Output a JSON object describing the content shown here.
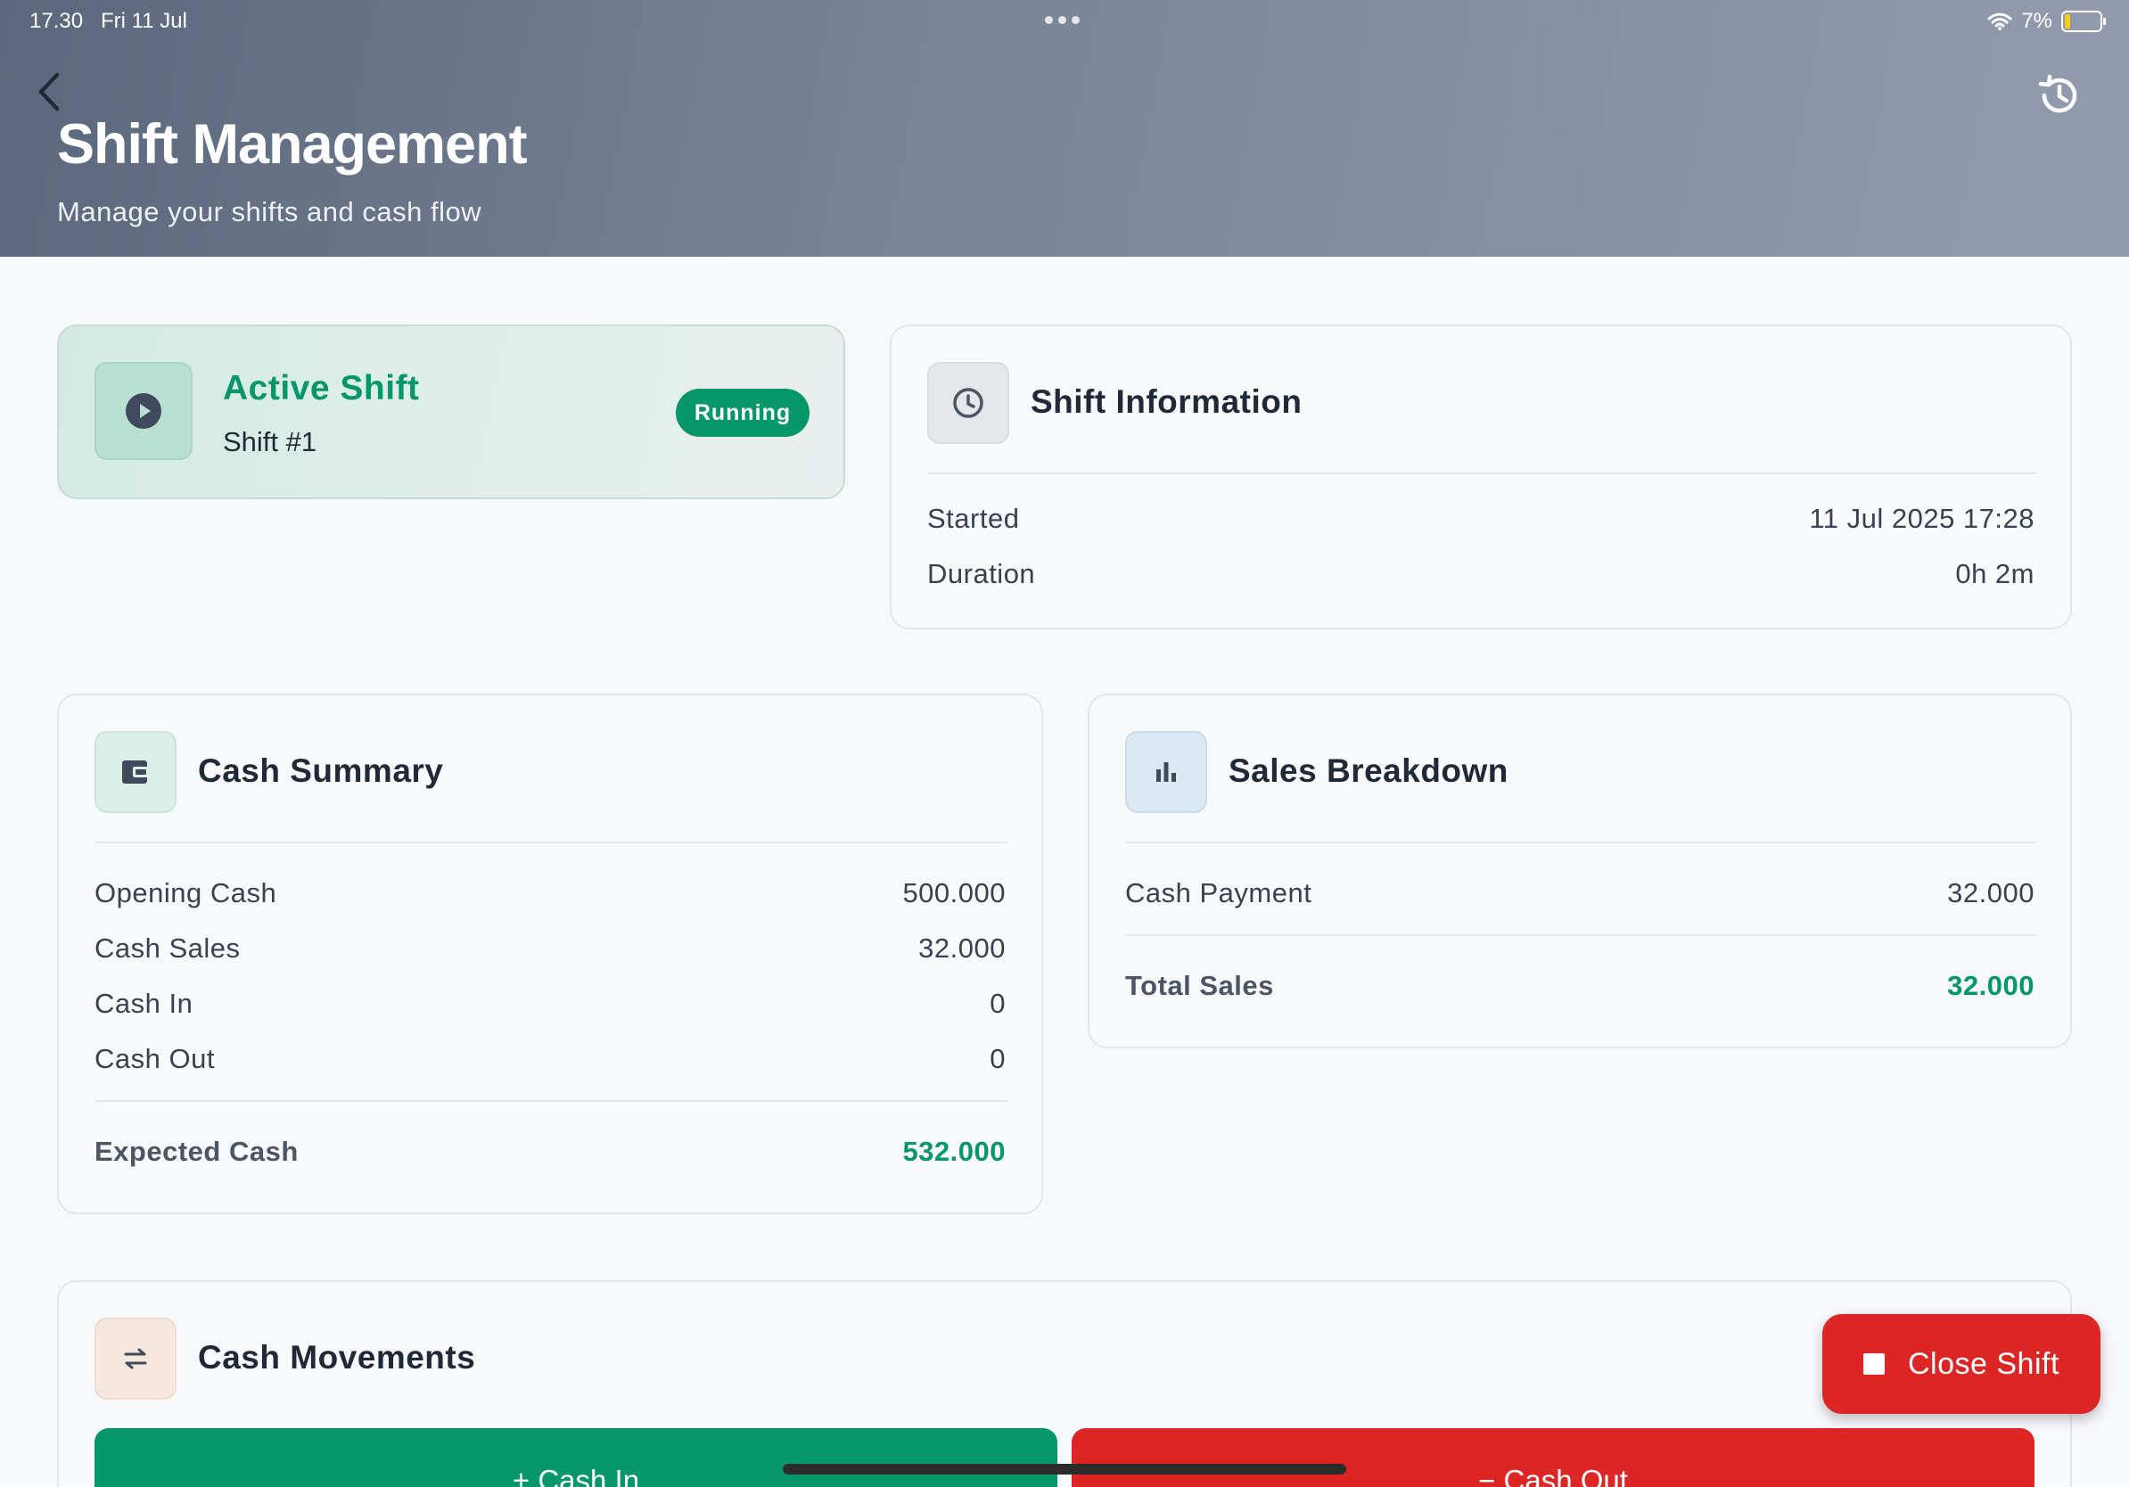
{
  "status_bar": {
    "time": "17.30",
    "date": "Fri 11 Jul",
    "battery": "7%"
  },
  "header": {
    "title": "Shift Management",
    "subtitle": "Manage your shifts and cash flow",
    "back_icon": "chevron-left-icon",
    "history_icon": "history-icon"
  },
  "active_shift": {
    "title": "Active Shift",
    "subtitle": "Shift #1",
    "badge": "Running",
    "icon": "play-circle-icon"
  },
  "shift_info": {
    "title": "Shift Information",
    "icon": "clock-icon",
    "rows": [
      {
        "label": "Started",
        "value": "11 Jul 2025 17:28"
      },
      {
        "label": "Duration",
        "value": "0h 2m"
      }
    ]
  },
  "cash_summary": {
    "title": "Cash Summary",
    "icon": "wallet-icon",
    "rows": [
      {
        "label": "Opening Cash",
        "value": "500.000"
      },
      {
        "label": "Cash Sales",
        "value": "32.000"
      },
      {
        "label": "Cash In",
        "value": "0"
      },
      {
        "label": "Cash Out",
        "value": "0"
      }
    ],
    "total": {
      "label": "Expected Cash",
      "value": "532.000"
    }
  },
  "sales_breakdown": {
    "title": "Sales Breakdown",
    "icon": "bar-chart-icon",
    "rows": [
      {
        "label": "Cash Payment",
        "value": "32.000"
      }
    ],
    "total": {
      "label": "Total Sales",
      "value": "32.000"
    }
  },
  "cash_movements": {
    "title": "Cash Movements",
    "icon": "swap-arrows-icon",
    "cash_in_label": "+ Cash In",
    "cash_out_label": "− Cash Out"
  },
  "close_shift": {
    "label": "Close Shift",
    "icon": "stop-icon"
  },
  "colors": {
    "accent_green": "#059669",
    "danger_red": "#dc2626",
    "header_start": "#5b677c",
    "header_end": "#939cae"
  }
}
